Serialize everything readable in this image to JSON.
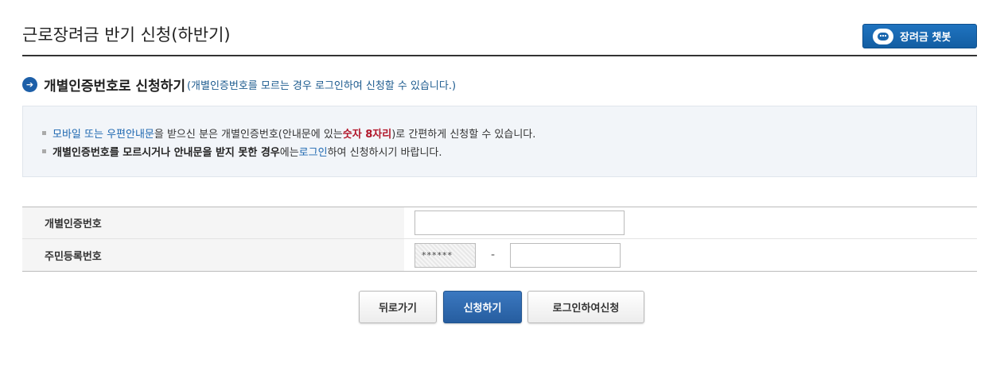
{
  "header": {
    "title": "근로장려금 반기 신청(하반기)",
    "chatbot_label": "장려금 챗봇",
    "chatbot_icon": "robot-icon"
  },
  "section": {
    "icon": "arrow-right-circle-icon",
    "title": "개별인증번호로 신청하기",
    "subtitle": "(개별인증번호를 모르는 경우 로그인하여 신청할 수 있습니다.)"
  },
  "info": {
    "line1": {
      "part1": "모바일 또는 우편안내문",
      "part2": "을 받으신 분은 개별인증번호(안내문에 있는 ",
      "part3": "숫자 8자리",
      "part4": ")로 간편하게 신청할 수 있습니다."
    },
    "line2": {
      "part1": "개별인증번호를 모르시거나 안내문을 받지 못한 경우",
      "part2": "에는 ",
      "part3": "로그인",
      "part4": "하여 신청하시기 바랍니다."
    }
  },
  "form": {
    "auth_label": "개별인증번호",
    "auth_value": "",
    "rrn_label": "주민등록번호",
    "rrn_front_masked": "******",
    "rrn_separator": "-",
    "rrn_back_value": ""
  },
  "buttons": {
    "back": "뒤로가기",
    "apply": "신청하기",
    "login_apply": "로그인하여신청"
  },
  "colors": {
    "accent_blue": "#1d67b0",
    "highlight_red": "#b1162a",
    "primary_button": "#2f6bb3"
  }
}
